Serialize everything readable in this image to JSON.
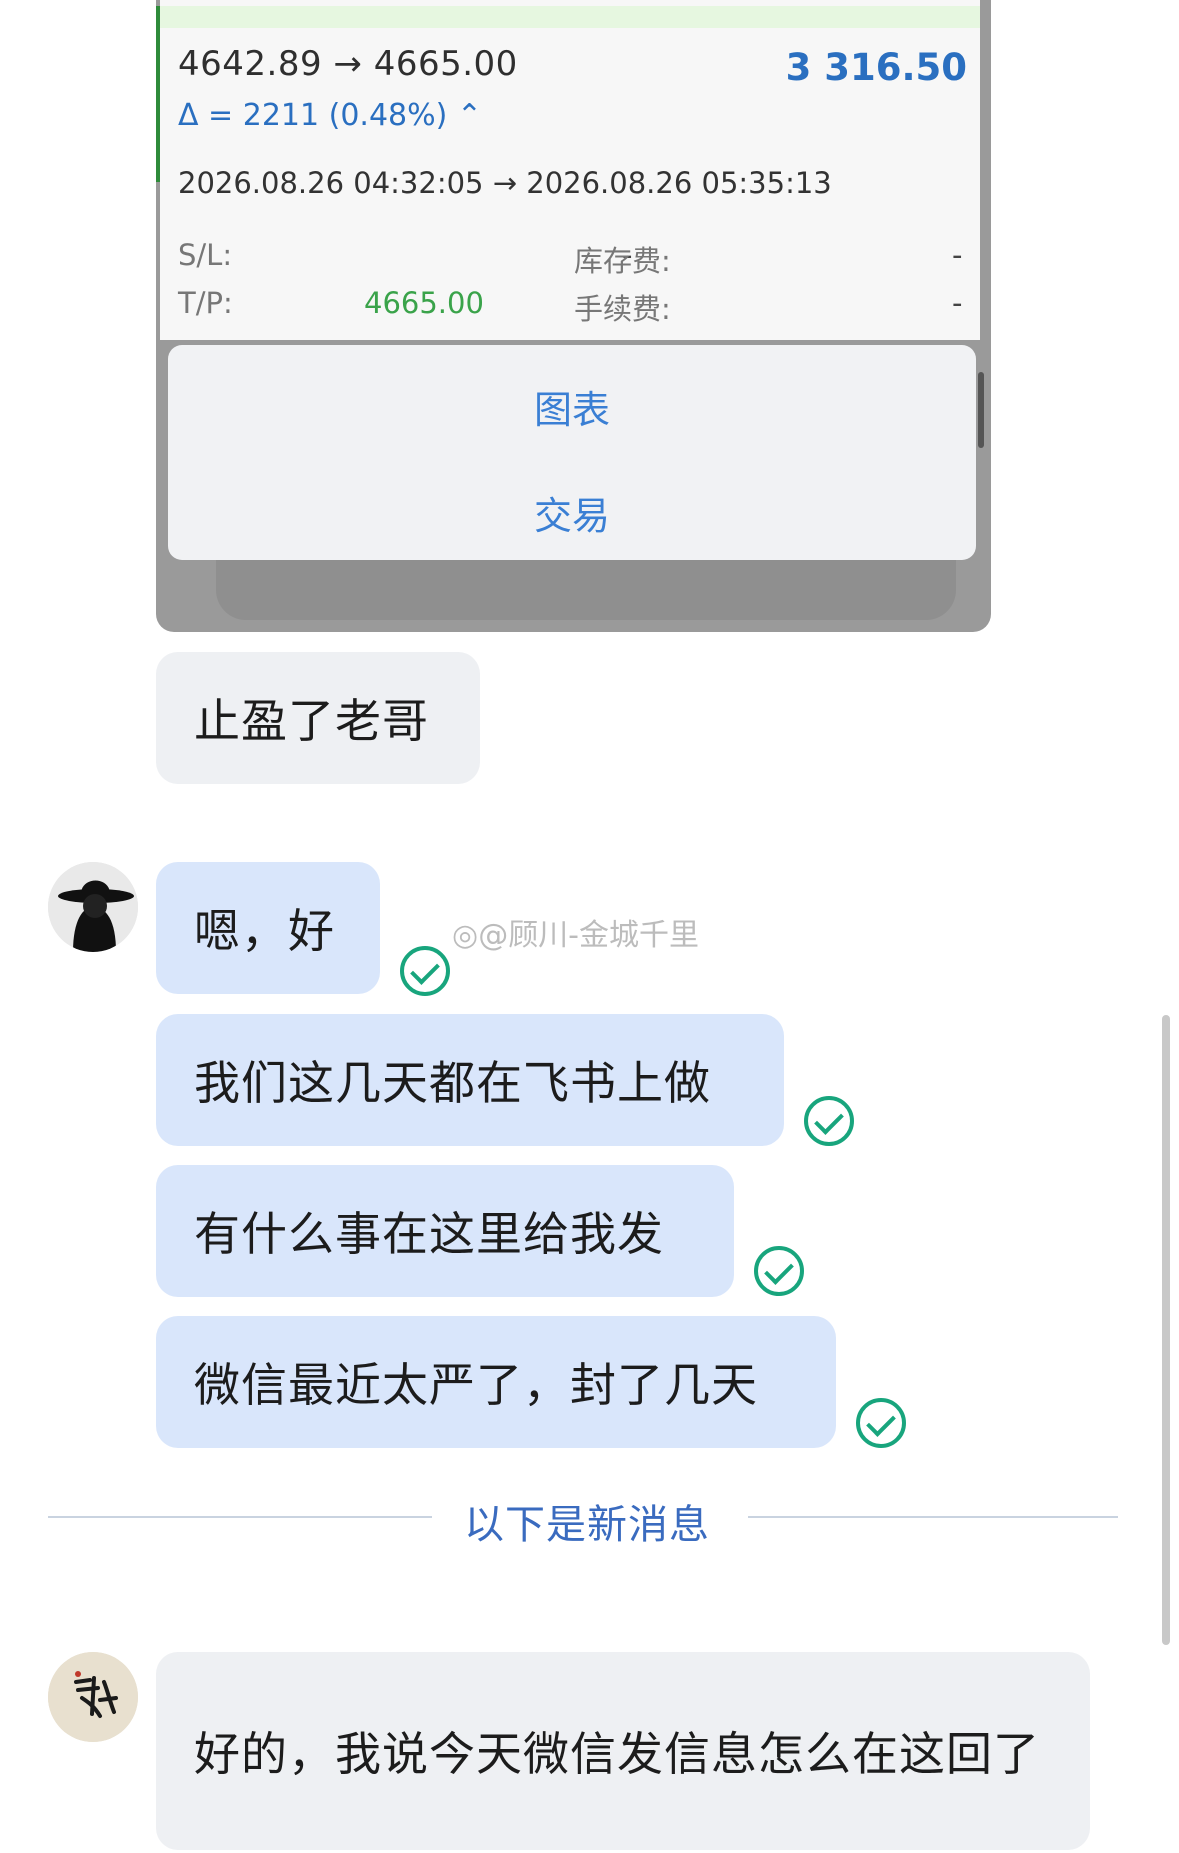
{
  "screenshot_card": {
    "price_route": "4642.89 → 4665.00",
    "profit": "3 316.50",
    "delta": "Δ = 2211 (0.48%) ⌃",
    "time_range": "2026.08.26 04:32:05 → 2026.08.26 05:35:13",
    "sl_label": "S/L:",
    "sl_value": "-",
    "tp_label": "T/P:",
    "tp_value": "4665.00",
    "swap_label": "库存费:",
    "swap_value": "-",
    "fee_label": "手续费:",
    "fee_value": "-",
    "menu_items": [
      "图表",
      "交易"
    ]
  },
  "messages": [
    {
      "text": "止盈了老哥"
    },
    {
      "text": "嗯，好"
    },
    {
      "text": "我们这几天都在飞书上做"
    },
    {
      "text": "有什么事在这里给我发"
    },
    {
      "text": "微信最近太严了，封了几天"
    }
  ],
  "divider_text": "以下是新消息",
  "last_message": "好的，我说今天微信发信息怎么在这回了",
  "watermark": "@顾川-金城千里",
  "colors": {
    "accent": "#3a6bbf",
    "bubble_blue": "#d9e6fb",
    "bubble_gray": "#eef0f3",
    "check_green": "#18a57d",
    "tp_green": "#3aa34a"
  }
}
